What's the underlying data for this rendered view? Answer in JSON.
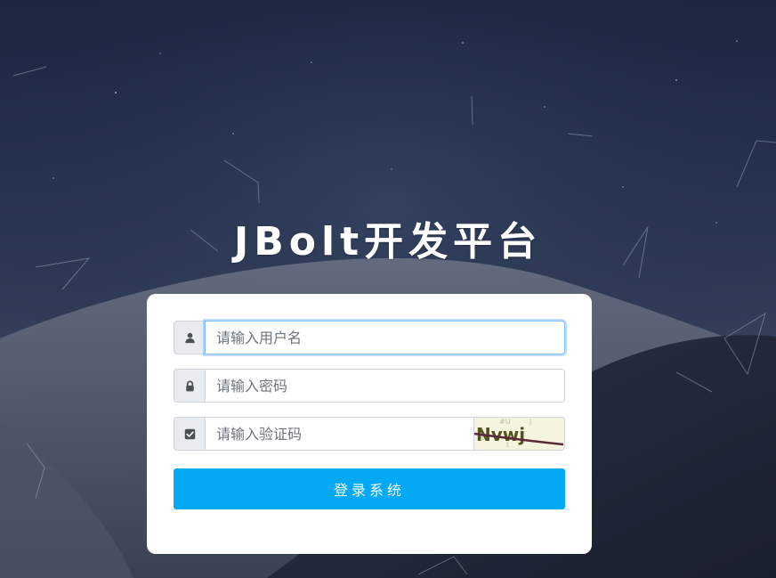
{
  "app_title": "JBolt开发平台",
  "login_form": {
    "username": {
      "placeholder": "请输入用户名",
      "value": "",
      "icon": "user-icon"
    },
    "password": {
      "placeholder": "请输入密码",
      "value": "",
      "icon": "lock-icon"
    },
    "captcha": {
      "placeholder": "请输入验证码",
      "value": "",
      "icon": "checkbox-icon",
      "image_text": "Nvwj"
    },
    "submit_label": "登录系统"
  },
  "colors": {
    "accent": "#03a9f4",
    "card_background": "#ffffff",
    "addon_background": "#e9ecef",
    "focus_border": "#80bdff"
  }
}
